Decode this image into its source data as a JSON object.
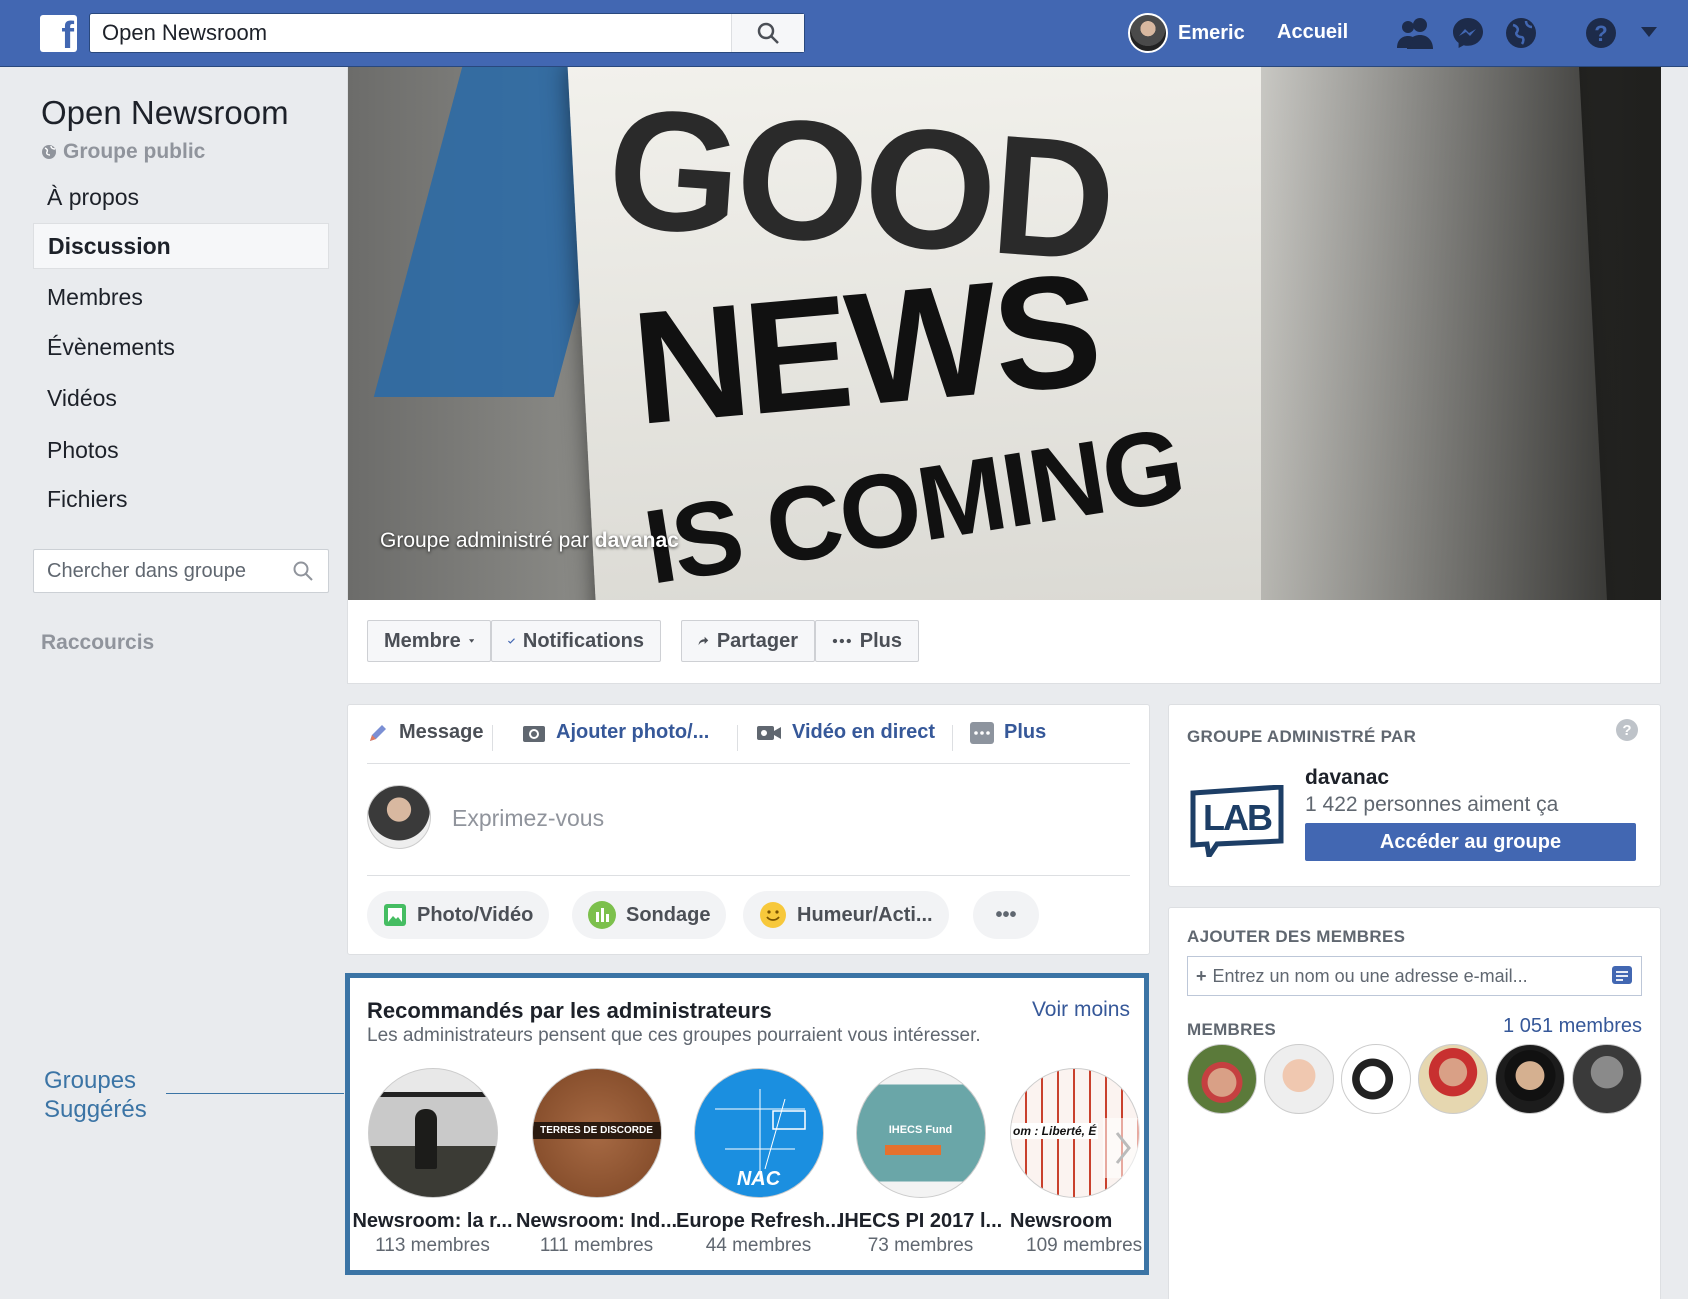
{
  "topbar": {
    "logo_letter": "f",
    "search_value": "Open Newsroom",
    "user_name": "Emeric",
    "home_label": "Accueil"
  },
  "sidebar": {
    "group_title": "Open Newsroom",
    "group_type": "Groupe public",
    "items": [
      {
        "label": "À propos"
      },
      {
        "label": "Discussion"
      },
      {
        "label": "Membres"
      },
      {
        "label": "Évènements"
      },
      {
        "label": "Vidéos"
      },
      {
        "label": "Photos"
      },
      {
        "label": "Fichiers"
      }
    ],
    "search_placeholder": "Chercher dans groupe",
    "shortcuts_label": "Raccourcis"
  },
  "cover": {
    "text_line1": "GOOD",
    "text_line2": "NEWS",
    "text_line3": "IS COMING",
    "caption_prefix": "Groupe administré par",
    "caption_admin": "davanac"
  },
  "actions": {
    "member": "Membre",
    "notifications": "Notifications",
    "share": "Partager",
    "more": "Plus"
  },
  "composer": {
    "tabs": [
      "Message",
      "Ajouter photo/...",
      "Vidéo en direct",
      "Plus"
    ],
    "placeholder": "Exprimez-vous",
    "pills": [
      "Photo/Vidéo",
      "Sondage",
      "Humeur/Acti..."
    ],
    "more_dots": "•••"
  },
  "recommended": {
    "title": "Recommandés par les administrateurs",
    "subtitle": "Les administrateurs pensent que ces groupes pourraient vous intéresser.",
    "toggle": "Voir moins",
    "groups": [
      {
        "name": "Newsroom: la r...",
        "members": "113 membres"
      },
      {
        "name": "Newsroom: Ind...",
        "members": "111 membres",
        "badge": "TERRES DE DISCORDE"
      },
      {
        "name": "Europe Refresh...",
        "members": "44 membres",
        "badge": "NAC"
      },
      {
        "name": "IHECS PI 2017 l...",
        "members": "73 membres",
        "badge": "IHECS Fund"
      },
      {
        "name": "Newsroom",
        "members": "109 membres",
        "badge": "om : Liberté, É"
      }
    ]
  },
  "annotation": {
    "line1": "Groupes",
    "line2": "Suggérés"
  },
  "admin_card": {
    "heading": "GROUPE ADMINISTRÉ PAR",
    "help": "?",
    "logo_text": "LAB",
    "name": "davanac",
    "likes": "1 422 personnes aiment ça",
    "button": "Accéder au groupe"
  },
  "members_card": {
    "heading": "AJOUTER DES MEMBRES",
    "input_placeholder": "Entrez un nom ou une adresse e-mail...",
    "members_label": "MEMBRES",
    "members_count": "1 051 membres"
  },
  "colors": {
    "brand": "#4267b2",
    "link": "#365899",
    "annotation": "#3b74a5"
  }
}
